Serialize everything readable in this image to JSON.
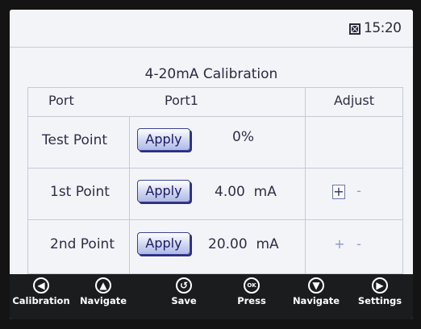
{
  "status": {
    "time": "15:20",
    "icon": "battery-icon"
  },
  "title": "4-20mA Calibration",
  "table": {
    "headers": {
      "port": "Port",
      "port1": "Port1",
      "adjust": "Adjust"
    },
    "rows": [
      {
        "label": "Test Point",
        "button": "Apply",
        "value": "0%"
      },
      {
        "label": "1st Point",
        "button": "Apply",
        "value": "4.00  mA"
      },
      {
        "label": "2nd Point",
        "button": "Apply",
        "value": "20.00  mA"
      }
    ],
    "adjust": {
      "plus": "+",
      "minus": "-"
    }
  },
  "footer": [
    {
      "icon": "arrow-left-icon",
      "glyph": "◀",
      "label": "Calibration"
    },
    {
      "icon": "arrow-up-icon",
      "glyph": "▲",
      "label": "Navigate"
    },
    {
      "icon": "undo-icon",
      "glyph": "↺",
      "label": "Save"
    },
    {
      "icon": "ok-icon",
      "glyph": "OK",
      "label": "Press"
    },
    {
      "icon": "arrow-down-icon",
      "glyph": "▼",
      "label": "Navigate"
    },
    {
      "icon": "arrow-right-icon",
      "glyph": "▶",
      "label": "Settings"
    }
  ]
}
